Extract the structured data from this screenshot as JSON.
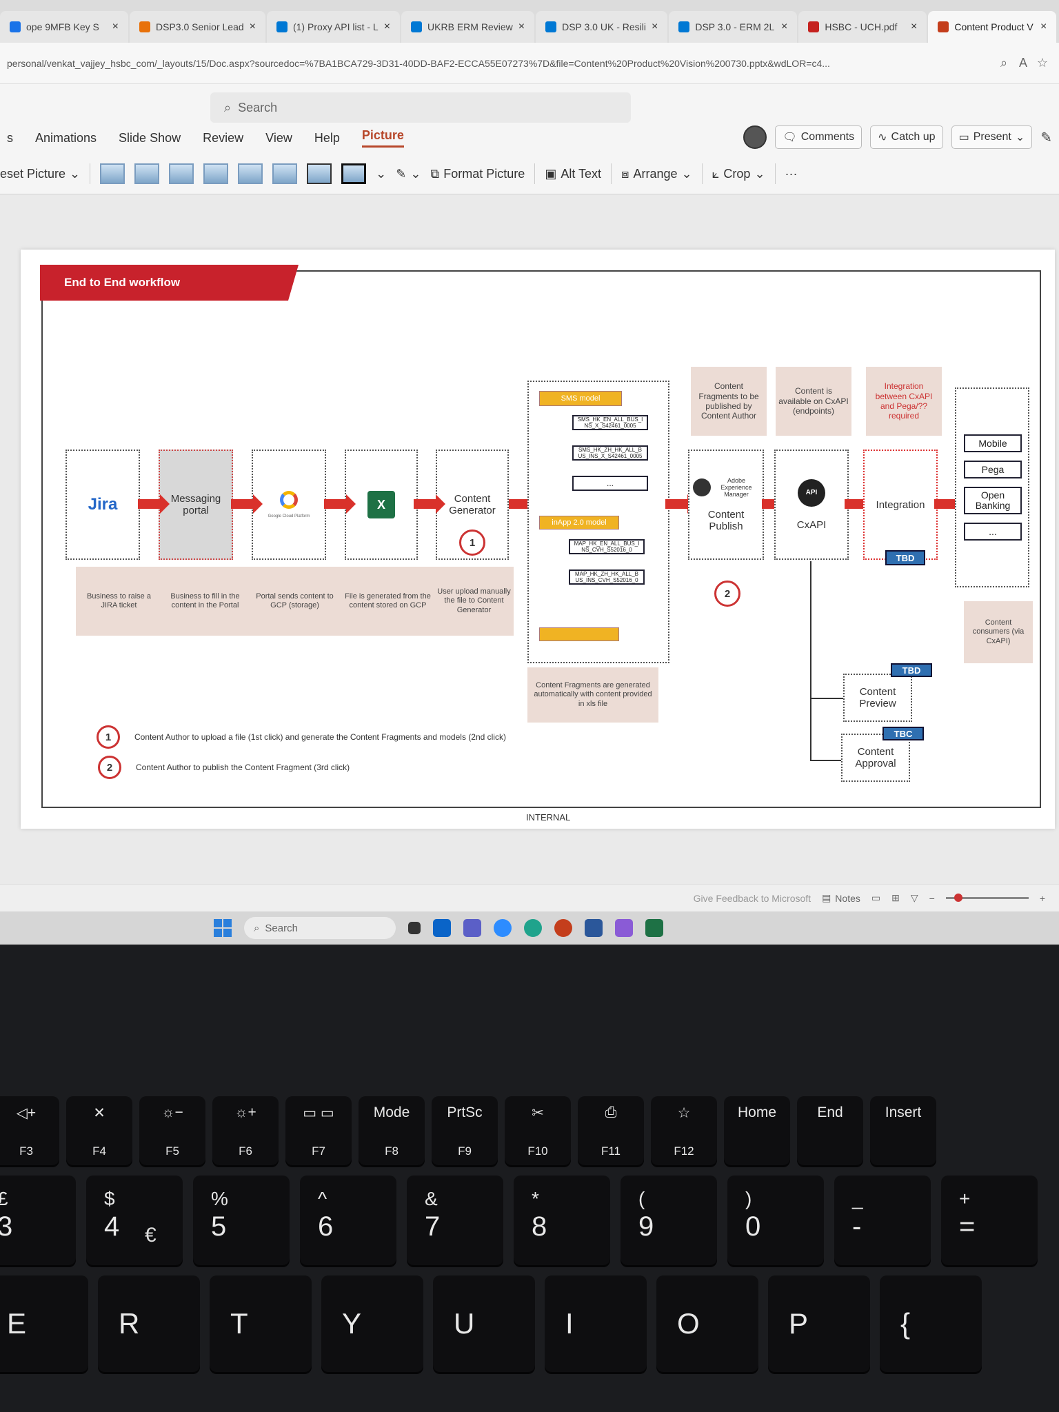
{
  "browser": {
    "tabs": [
      {
        "label": "ope 9MFB Key S",
        "color": "#1a73e8"
      },
      {
        "label": "DSP3.0 Senior Lead",
        "color": "#e8710a"
      },
      {
        "label": "(1) Proxy API list - L",
        "color": "#0078d4"
      },
      {
        "label": "UKRB ERM Review",
        "color": "#0078d4"
      },
      {
        "label": "DSP 3.0 UK - Resili",
        "color": "#0078d4"
      },
      {
        "label": "DSP 3.0 - ERM 2L",
        "color": "#0078d4"
      },
      {
        "label": "HSBC - UCH.pdf",
        "color": "#c5221f"
      },
      {
        "label": "Content Product V",
        "color": "#c43e1c"
      }
    ],
    "url": "personal/venkat_vajjey_hsbc_com/_layouts/15/Doc.aspx?sourcedoc=%7BA1BCA729-3D31-40DD-BAF2-ECCA55E07273%7D&file=Content%20Product%20Vision%200730.pptx&wdLOR=c4..."
  },
  "ribbon": {
    "search_placeholder": "Search",
    "menu": [
      "Animations",
      "Slide Show",
      "Review",
      "View",
      "Help",
      "Picture"
    ],
    "active_menu": "Picture",
    "reset_picture": "eset Picture",
    "format_picture": "Format Picture",
    "alt_text": "Alt Text",
    "arrange": "Arrange",
    "crop": "Crop",
    "more": "···",
    "comments": "Comments",
    "catch_up": "Catch up",
    "present": "Present"
  },
  "slide": {
    "title": "End to End workflow",
    "steps": [
      {
        "label": "Jira",
        "desc": "Business to raise a JIRA ticket"
      },
      {
        "label": "Messaging portal",
        "desc": "Business to fill in the content in the Portal"
      },
      {
        "label": "Google Cloud Platform",
        "desc": "Portal sends content to GCP (storage)"
      },
      {
        "label": "X",
        "desc": "File is generated from the content stored on GCP"
      },
      {
        "label": "Content Generator",
        "desc": "User upload manually the file to Content Generator"
      }
    ],
    "models": {
      "sms_title": "SMS model",
      "sms_items": [
        "SMS_HK_EN_ALL_BUS_I NS_X_S42461_0005",
        "SMS_HK_ZH_HK_ALL_B US_INS_X_S42461_0005",
        "..."
      ],
      "inapp_title": "inApp 2.0 model",
      "inapp_items": [
        "MAP_HK_EN_ALL_BUS_I NS_CVH_S52016_0",
        "MAP_HK_ZH_HK_ALL_B US_INS_CVH_S52016_0"
      ],
      "desc": "Content Fragments are generated automatically with content provided in xls file"
    },
    "publish": {
      "desc": "Content Fragments to be published by Content Author",
      "logo": "Adobe Experience Manager",
      "label": "Content Publish"
    },
    "cxapi": {
      "desc": "Content is available on CxAPI (endpoints)",
      "label": "CxAPI",
      "icon": "API"
    },
    "integration": {
      "desc": "Integration between CxAPI and Pega/?? required",
      "label": "Integration",
      "tag": "TBD"
    },
    "consumers": {
      "items": [
        "Mobile",
        "Pega",
        "Open Banking",
        "..."
      ],
      "desc": "Content consumers (via CxAPI)"
    },
    "preview": {
      "label": "Content Preview",
      "tag": "TBD"
    },
    "approval": {
      "label": "Content Approval",
      "tag": "TBC"
    },
    "legend": [
      {
        "num": "1",
        "text": "Content Author to upload a file (1st click) and generate the Content Fragments and models (2nd click)"
      },
      {
        "num": "2",
        "text": "Content Author to publish the Content Fragment (3rd click)"
      }
    ],
    "footer": "INTERNAL"
  },
  "status": {
    "feedback": "Give Feedback to Microsoft",
    "notes": "Notes",
    "zoom_level": 0.1
  },
  "taskbar": {
    "search": "Search"
  },
  "keyboard": {
    "fkeys": [
      {
        "top": "◁+",
        "sub": "F3"
      },
      {
        "top": "✕",
        "sub": "F4"
      },
      {
        "top": "☼−",
        "sub": "F5"
      },
      {
        "top": "☼+",
        "sub": "F6"
      },
      {
        "top": "▭ ▭",
        "sub": "F7"
      },
      {
        "top": "Mode",
        "sub": "F8"
      },
      {
        "top": "PrtSc",
        "sub": "F9"
      },
      {
        "top": "✂",
        "sub": "F10"
      },
      {
        "top": "⎙",
        "sub": "F11"
      },
      {
        "top": "☆",
        "sub": "F12"
      },
      {
        "top": "Home",
        "sub": ""
      },
      {
        "top": "End",
        "sub": ""
      },
      {
        "top": "Insert",
        "sub": ""
      }
    ],
    "numkeys": [
      {
        "upper": "£",
        "lower": "3"
      },
      {
        "upper": "$",
        "lower": "4"
      },
      {
        "upper": "%",
        "lower": "5"
      },
      {
        "upper": "^",
        "lower": "6"
      },
      {
        "upper": "&",
        "lower": "7"
      },
      {
        "upper": "*",
        "lower": "8"
      },
      {
        "upper": "(",
        "lower": "9"
      },
      {
        "upper": ")",
        "lower": "0"
      },
      {
        "upper": "_",
        "lower": "-"
      },
      {
        "upper": "+",
        "lower": "="
      }
    ],
    "euro": "€",
    "letters": [
      "E",
      "R",
      "T",
      "Y",
      "U",
      "I",
      "O",
      "P",
      "{"
    ]
  }
}
